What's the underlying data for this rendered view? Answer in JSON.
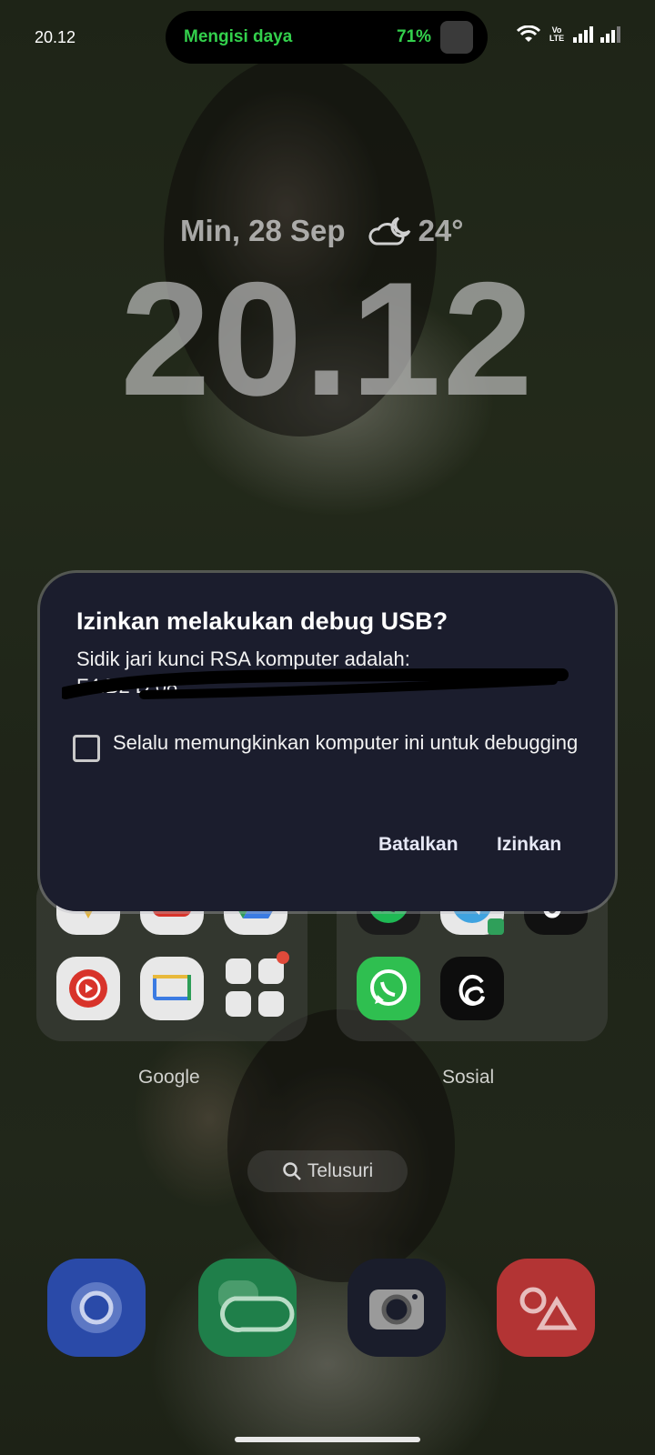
{
  "status_bar": {
    "time": "20.12",
    "charging_label": "Mengisi daya",
    "battery_percent": "71%",
    "volte_label": "Vo LTE",
    "icons": [
      "wifi-icon",
      "volte-icon",
      "signal-icon",
      "signal-icon"
    ]
  },
  "lock_clock": {
    "date": "Min, 28 Sep",
    "weather_icon": "cloud-moon-icon",
    "temperature": "24°",
    "time": "20.12"
  },
  "dialog": {
    "title": "Izinkan melakukan debug USB?",
    "body": "Sidik jari kunci RSA komputer adalah:",
    "fingerprint_visible": "F4:B2 D.08",
    "checkbox_label": "Selalu memungkinkan komputer ini untuk debugging",
    "checkbox_checked": false,
    "cancel_label": "Batalkan",
    "allow_label": "Izinkan"
  },
  "home": {
    "folders": [
      {
        "label": "Google",
        "apps": [
          "google-maps-icon",
          "youtube-icon",
          "google-drive-icon",
          "youtube-music-icon",
          "google-tv-icon",
          "google-apps-mini-folder-icon"
        ]
      },
      {
        "label": "Sosial",
        "apps": [
          "spotify-icon",
          "telegram-icon",
          "tiktok-icon",
          "whatsapp-icon",
          "threads-icon"
        ]
      }
    ],
    "search_label": "Telusuri",
    "dock": [
      "browser-icon",
      "messages-icon",
      "camera-icon",
      "gallery-icon"
    ]
  },
  "colors": {
    "dialog_bg": "#1b1d2d",
    "charging_green": "#33d04c",
    "button_text": "#e6e8f5"
  }
}
